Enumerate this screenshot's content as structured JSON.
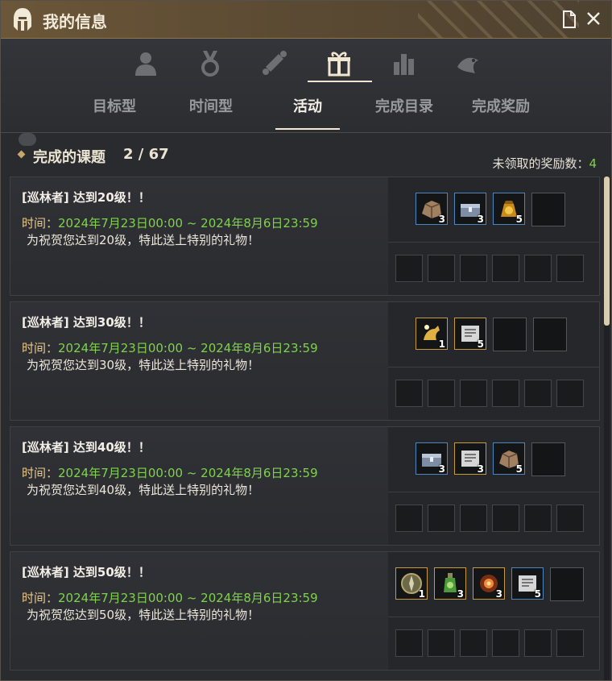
{
  "window": {
    "title": "我的信息"
  },
  "icon_tabs": [
    "person-icon",
    "medal-icon",
    "scroll-icon",
    "gift-icon",
    "bar-chart-icon",
    "fish-icon"
  ],
  "subtabs": [
    "目标型",
    "时间型",
    "活动",
    "完成目录",
    "完成奖励"
  ],
  "active_subtab": "活动",
  "summary": {
    "label": "完成的课题",
    "count": "2 / 67",
    "unclaimed_label": "未领取的奖励数：",
    "unclaimed_count": "4"
  },
  "colors": {
    "accent_green": "#7fd34a",
    "time_label": "#e9c987",
    "title_bar": "#6b5638"
  },
  "quests": [
    {
      "title": "[巡林者] 达到20级！！",
      "time_label": "时间：",
      "time_value": "2024年7月23日00:00 ~ 2024年8月6日23:59",
      "desc": "为祝贺您达到20级，特此送上特别的礼物！",
      "rewards": [
        {
          "icon": "rock-ore-icon",
          "qty": "3",
          "frame": "blue"
        },
        {
          "icon": "silver-chest-icon",
          "qty": "3",
          "frame": "blue"
        },
        {
          "icon": "gold-pouch-icon",
          "qty": "5",
          "frame": "blue"
        }
      ]
    },
    {
      "title": "[巡林者] 达到30级！！",
      "time_label": "时间：",
      "time_value": "2024年7月23日00:00 ~ 2024年8月6日23:59",
      "desc": "为祝贺您达到30级，特此送上特别的礼物！",
      "rewards": [
        {
          "icon": "golden-horse-icon",
          "qty": "1",
          "frame": "gold"
        },
        {
          "icon": "scroll-certificate-icon",
          "qty": "5",
          "frame": "gold"
        }
      ]
    },
    {
      "title": "[巡林者] 达到40级！！",
      "time_label": "时间：",
      "time_value": "2024年7月23日00:00 ~ 2024年8月6日23:59",
      "desc": "为祝贺您达到40级，特此送上特别的礼物！",
      "rewards": [
        {
          "icon": "silver-chest-icon",
          "qty": "3",
          "frame": "blue"
        },
        {
          "icon": "scroll-certificate-icon",
          "qty": "3",
          "frame": "gold"
        },
        {
          "icon": "rock-ore-icon",
          "qty": "5",
          "frame": "blue"
        }
      ]
    },
    {
      "title": "[巡林者] 达到50级！！",
      "time_label": "时间：",
      "time_value": "2024年7月23日00:00 ~ 2024年8月6日23:59",
      "desc": "为祝贺您达到50级，特此送上特别的礼物！",
      "rewards": [
        {
          "icon": "compass-icon",
          "qty": "1",
          "frame": "gold"
        },
        {
          "icon": "green-potion-icon",
          "qty": "3",
          "frame": "gold"
        },
        {
          "icon": "fire-orb-icon",
          "qty": "3",
          "frame": "gold"
        },
        {
          "icon": "scroll-certificate-icon",
          "qty": "5",
          "frame": "blue"
        }
      ]
    }
  ]
}
